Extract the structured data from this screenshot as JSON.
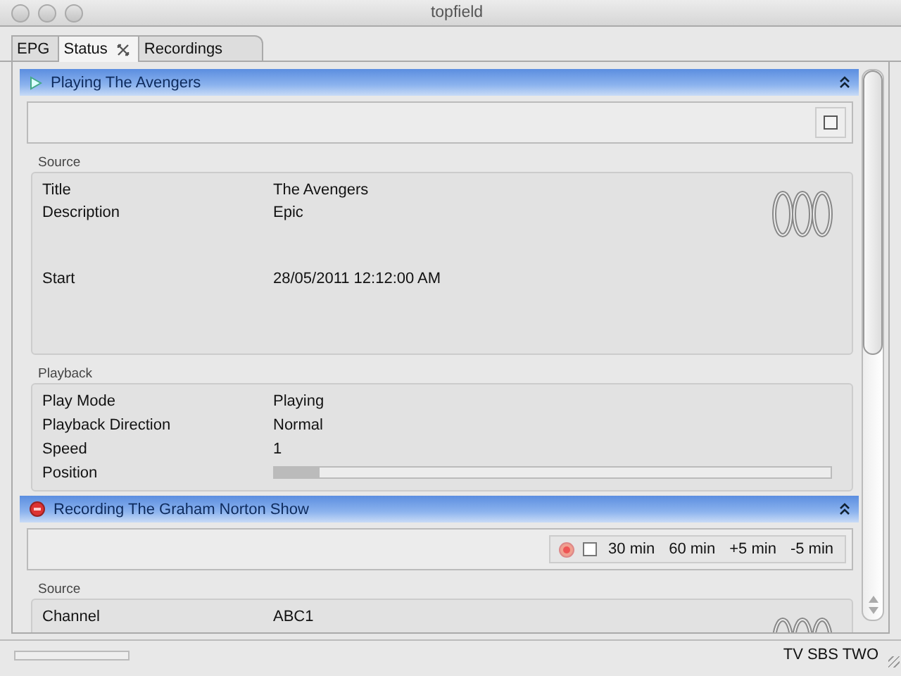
{
  "window": {
    "title": "topfield"
  },
  "tabs": [
    {
      "label": "EPG",
      "selected": false,
      "closable": false
    },
    {
      "label": "Status",
      "selected": true,
      "closable": true
    },
    {
      "label": "Recordings",
      "selected": false,
      "closable": false
    }
  ],
  "sections": [
    {
      "kind": "playing",
      "title": "Playing The Avengers",
      "expanded": true,
      "toolbar": [
        {
          "kind": "stop"
        }
      ],
      "groups": [
        {
          "title": "Source",
          "logo": true,
          "rows": [
            {
              "kind": "text",
              "label": "Title",
              "value": "The Avengers"
            },
            {
              "kind": "text",
              "label": "Description",
              "value": "Epic",
              "multiline": true
            },
            {
              "kind": "text",
              "label": "Start",
              "value": "28/05/2011 12:12:00 AM"
            }
          ]
        },
        {
          "title": "Playback",
          "logo": false,
          "rows": [
            {
              "kind": "text",
              "label": "Play Mode",
              "value": "Playing"
            },
            {
              "kind": "text",
              "label": "Playback Direction",
              "value": "Normal"
            },
            {
              "kind": "text",
              "label": "Speed",
              "value": "1"
            },
            {
              "kind": "progress",
              "label": "Position",
              "level": 0.08
            }
          ]
        }
      ]
    },
    {
      "kind": "recording",
      "title": "Recording The Graham Norton Show",
      "expanded": true,
      "toolbar": [
        {
          "kind": "record"
        },
        {
          "kind": "checkbox",
          "checked": false
        },
        {
          "kind": "button",
          "label": "30 min"
        },
        {
          "kind": "button",
          "label": "60 min"
        },
        {
          "kind": "button",
          "label": "+5 min"
        },
        {
          "kind": "button",
          "label": "-5 min"
        }
      ],
      "groups": [
        {
          "title": "Source",
          "logo": true,
          "rows": [
            {
              "kind": "text",
              "label": "Channel",
              "value": "ABC1"
            }
          ]
        }
      ]
    }
  ],
  "status_bar": {
    "level": 0,
    "text": "TV SBS TWO"
  }
}
